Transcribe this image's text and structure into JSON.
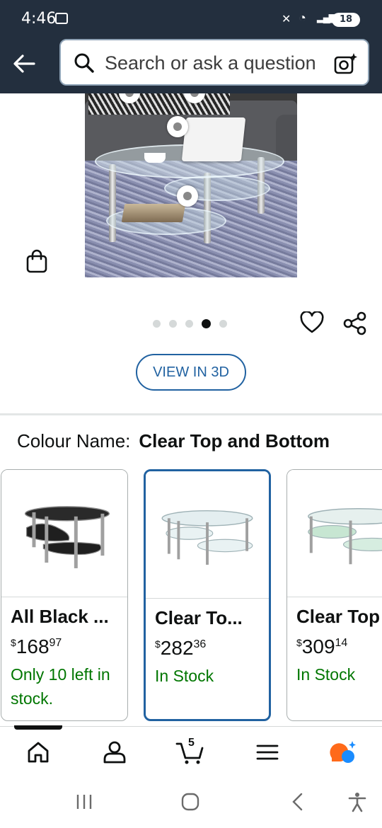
{
  "status_bar": {
    "time": "4:46",
    "battery": "18",
    "icons": [
      "screenshot-icon",
      "mute-icon",
      "wifi-icon",
      "signal-icon",
      "battery-icon"
    ]
  },
  "header": {
    "back_icon": "arrow-left-icon",
    "search_placeholder": "Search or ask a question",
    "search_icon": "magnifier-icon",
    "camera_icon": "camera-sparkle-icon"
  },
  "gallery": {
    "total_images": 5,
    "active_index": 3,
    "actions": [
      "heart-icon",
      "share-icon"
    ],
    "view_3d_label": "VIEW IN 3D"
  },
  "colour": {
    "label": "Colour Name:",
    "value": "Clear Top and Bottom"
  },
  "variants": [
    {
      "title": "All Black ...",
      "price_symbol": "$",
      "price_whole": "168",
      "price_cents": "97",
      "stock": "Only 10 left in stock.",
      "selected": false,
      "glass": "black"
    },
    {
      "title": "Clear To...",
      "price_symbol": "$",
      "price_whole": "282",
      "price_cents": "36",
      "stock": "In Stock",
      "selected": true,
      "glass": "clear"
    },
    {
      "title": "Clear Top",
      "price_symbol": "$",
      "price_whole": "309",
      "price_cents": "14",
      "stock": "In Stock",
      "selected": false,
      "glass": "frosted"
    }
  ],
  "bottom_nav": {
    "items": [
      "home-icon",
      "account-icon",
      "cart-icon",
      "menu-icon",
      "rufus-icon"
    ],
    "cart_count": "5",
    "active": "home-icon"
  },
  "colors": {
    "header_bg": "#232f3e",
    "link_blue": "#2162a1",
    "stock_green": "#007600",
    "rufus_orange": "#ff6a1a",
    "rufus_blue": "#1a8cff"
  }
}
